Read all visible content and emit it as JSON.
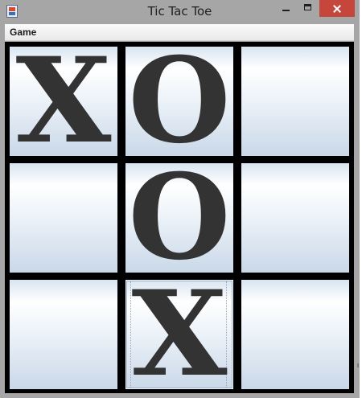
{
  "window": {
    "title": "Tic Tac Toe",
    "app_icon": "java-icon",
    "controls": [
      "minimize-icon",
      "maximize-icon",
      "close-icon"
    ]
  },
  "menubar": {
    "items": [
      {
        "label": "Game"
      }
    ]
  },
  "board": {
    "cells": [
      {
        "value": "X"
      },
      {
        "value": "O"
      },
      {
        "value": ""
      },
      {
        "value": ""
      },
      {
        "value": "O"
      },
      {
        "value": ""
      },
      {
        "value": ""
      },
      {
        "value": "X"
      },
      {
        "value": ""
      }
    ],
    "focused_cell": 7
  },
  "colors": {
    "title_bar": "#a6a6a6",
    "close_button": "#c7463b",
    "grid_lines": "#000000",
    "mark": "#333333"
  }
}
